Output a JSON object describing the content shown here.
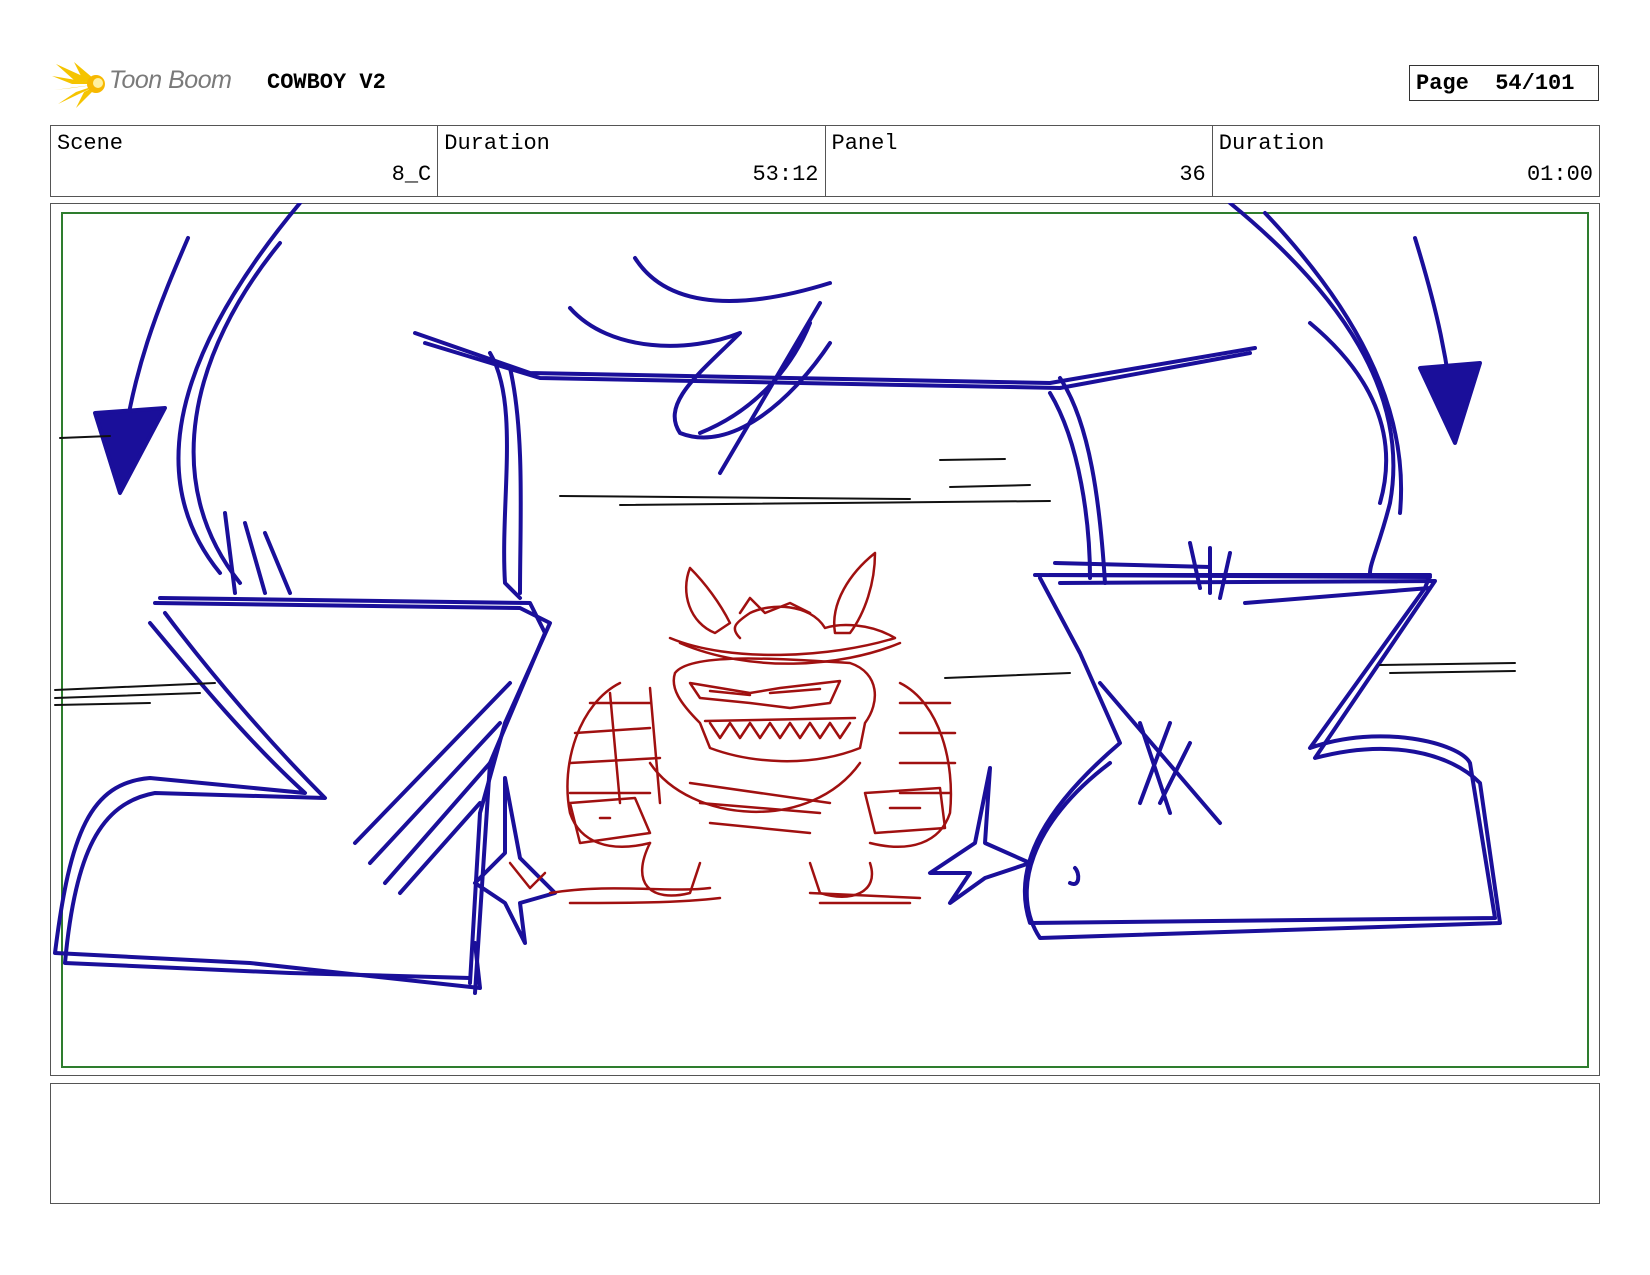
{
  "header": {
    "logo_text": "Toon Boom",
    "project_title": "COWBOY V2",
    "page_label": "Page",
    "page_value": "54/101"
  },
  "info": {
    "scene_label": "Scene",
    "scene_value": "8_C",
    "scene_duration_label": "Duration",
    "scene_duration_value": "53:12",
    "panel_label": "Panel",
    "panel_value": "36",
    "panel_duration_label": "Duration",
    "panel_duration_value": "01:00"
  },
  "colors": {
    "arrow_blue": "#1a0f9a",
    "character_red": "#a01010",
    "safe_frame_green": "#2e7d2e",
    "logo_yellow": "#f5c400"
  },
  "notes": {
    "text": ""
  }
}
